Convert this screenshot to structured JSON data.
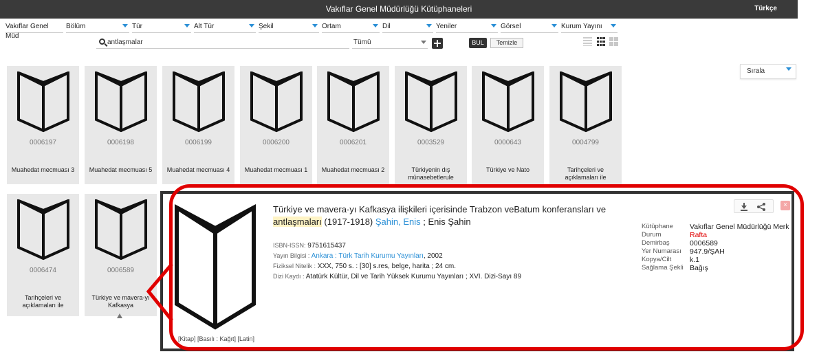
{
  "header": {
    "title": "Vakıflar Genel Müdürlüğü Kütüphaneleri",
    "language": "Türkçe"
  },
  "filters": [
    {
      "label": "Vakıflar Genel Müd"
    },
    {
      "label": "Bölüm"
    },
    {
      "label": "Tür"
    },
    {
      "label": "Alt Tür"
    },
    {
      "label": "Şekil"
    },
    {
      "label": "Ortam"
    },
    {
      "label": "Dil"
    },
    {
      "label": "Yeniler"
    },
    {
      "label": "Görsel"
    },
    {
      "label": "Kurum Yayını"
    }
  ],
  "search": {
    "value": "antlaşmalar",
    "scope": "Tümü",
    "find_label": "BUL",
    "clear_label": "Temizle"
  },
  "sort": {
    "label": "Sırala"
  },
  "cards": [
    {
      "number": "0006197",
      "title": "Muahedat mecmuası 3"
    },
    {
      "number": "0006198",
      "title": "Muahedat mecmuası 5"
    },
    {
      "number": "0006199",
      "title": "Muahedat mecmuası 4"
    },
    {
      "number": "0006200",
      "title": "Muahedat mecmuası 1"
    },
    {
      "number": "0006201",
      "title": "Muahedat mecmuası 2"
    },
    {
      "number": "0003529",
      "title": "Türkiyenin dış münasebetlerule"
    },
    {
      "number": "0000643",
      "title": "Türkiye ve Nato"
    },
    {
      "number": "0004799",
      "title": "Tarihçeleri ve açıklamaları ile"
    },
    {
      "number": "0006474",
      "title": "Tarihçeleri ve açıklamaları ile"
    },
    {
      "number": "0006589",
      "title": "Türkiye ve mavera-yı Kafkasya"
    }
  ],
  "detail": {
    "title_part1": "Türkiye ve mavera-yı Kafkasya ilişkileri içerisinde Trabzon veBatum konferansları ve ",
    "title_highlight": "antlaşmaları",
    "title_part2": " (1917-1918) ",
    "author_link": "Şahin, Enis",
    "author_rest": " ; Enis Şahin",
    "isbn_label": "ISBN-ISSN:",
    "isbn": "9751615437",
    "pub_label": "Yayın Bilgisi :",
    "pub_link": "Ankara : Türk Tarih Kurumu Yayınları",
    "pub_year": ", 2002",
    "phys_label": "Fiziksel Nitelik :",
    "phys": "XXX, 750 s. : [30] s.res, belge, harita ; 24 cm.",
    "series_label": "Dizi Kaydı :",
    "series": "Atatürk Kültür, Dil ve Tarih Yüksek Kurumu Yayınları ; XVI. Dizi-Sayı 89",
    "format": "[Kitap] [Basılı : Kağıt] [Latin]",
    "side": [
      {
        "label": "Kütüphane",
        "value": "Vakıflar Genel Müdürlüğü Merk",
        "red": false
      },
      {
        "label": "Durum",
        "value": "Rafta",
        "red": true
      },
      {
        "label": "Demirbaş",
        "value": "0006589",
        "red": false
      },
      {
        "label": "Yer Numarası",
        "value": "947.9/ŞAH",
        "red": false
      },
      {
        "label": "Kopya/Cilt",
        "value": "k.1",
        "red": false
      },
      {
        "label": "Sağlama Şekli",
        "value": "Bağış",
        "red": false
      }
    ],
    "close_symbol": "×"
  },
  "colors": {
    "topbar": "#3a3a3a",
    "accent": "#2a8fd6",
    "annotation": "#e00000",
    "highlight": "#fff3c4"
  }
}
